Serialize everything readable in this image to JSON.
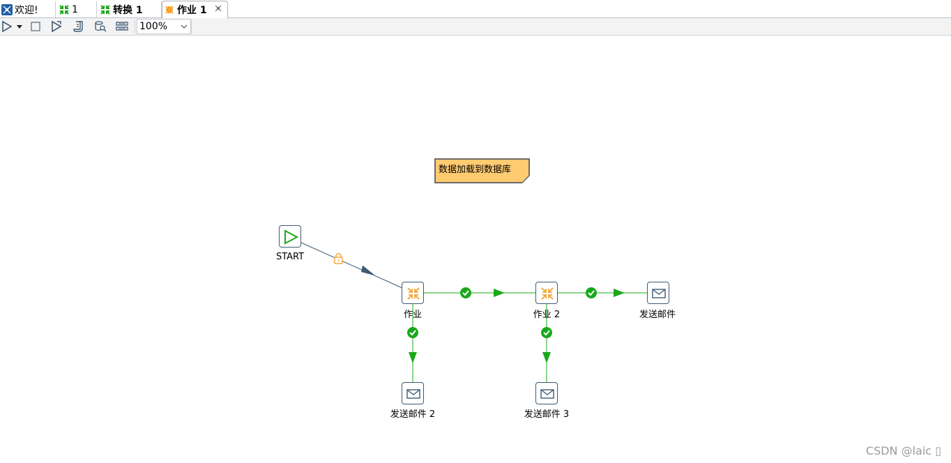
{
  "tabs": [
    {
      "label": "欢迎!",
      "icon": "welcome-icon",
      "bold": false
    },
    {
      "label": "1",
      "icon": "transformation-icon",
      "bold": false
    },
    {
      "label": "转换 1",
      "icon": "transformation-icon",
      "bold": true
    },
    {
      "label": "作业 1",
      "icon": "job-icon",
      "bold": true,
      "active": true,
      "close_icon": "close-icon"
    }
  ],
  "toolbar": {
    "buttons": [
      "run-icon",
      "run-dropdown-icon",
      "stop-icon",
      "replay-icon",
      "sql-icon",
      "explore-db-icon",
      "impact-icon"
    ],
    "zoom_value": "100%"
  },
  "canvas": {
    "note": "数据加载到数据库",
    "nodes": [
      {
        "id": "start",
        "label": "START",
        "type": "start-icon"
      },
      {
        "id": "job1",
        "label": "作业",
        "type": "job-icon"
      },
      {
        "id": "job2",
        "label": "作业 2",
        "type": "job-icon"
      },
      {
        "id": "mail1",
        "label": "发送邮件",
        "type": "mail-icon"
      },
      {
        "id": "mail2",
        "label": "发送邮件 2",
        "type": "mail-icon"
      },
      {
        "id": "mail3",
        "label": "发送邮件 3",
        "type": "mail-icon"
      }
    ],
    "hops": [
      {
        "from": "START",
        "to": "作业",
        "condition": "unconditional",
        "icon": "lock-icon"
      },
      {
        "from": "作业",
        "to": "作业 2",
        "condition": "success",
        "icon": "check-icon"
      },
      {
        "from": "作业 2",
        "to": "发送邮件",
        "condition": "success",
        "icon": "check-icon"
      },
      {
        "from": "作业",
        "to": "发送邮件 2",
        "condition": "success",
        "icon": "check-icon"
      },
      {
        "from": "作业 2",
        "to": "发送邮件 3",
        "condition": "success",
        "icon": "check-icon"
      }
    ],
    "colors": {
      "success_hop": "#1aa81a",
      "unconditional_hop": "#3e5a73",
      "note_fill": "#ffcb70",
      "job_icon": "#f39c1f"
    }
  },
  "watermark": "CSDN @laic ▯"
}
